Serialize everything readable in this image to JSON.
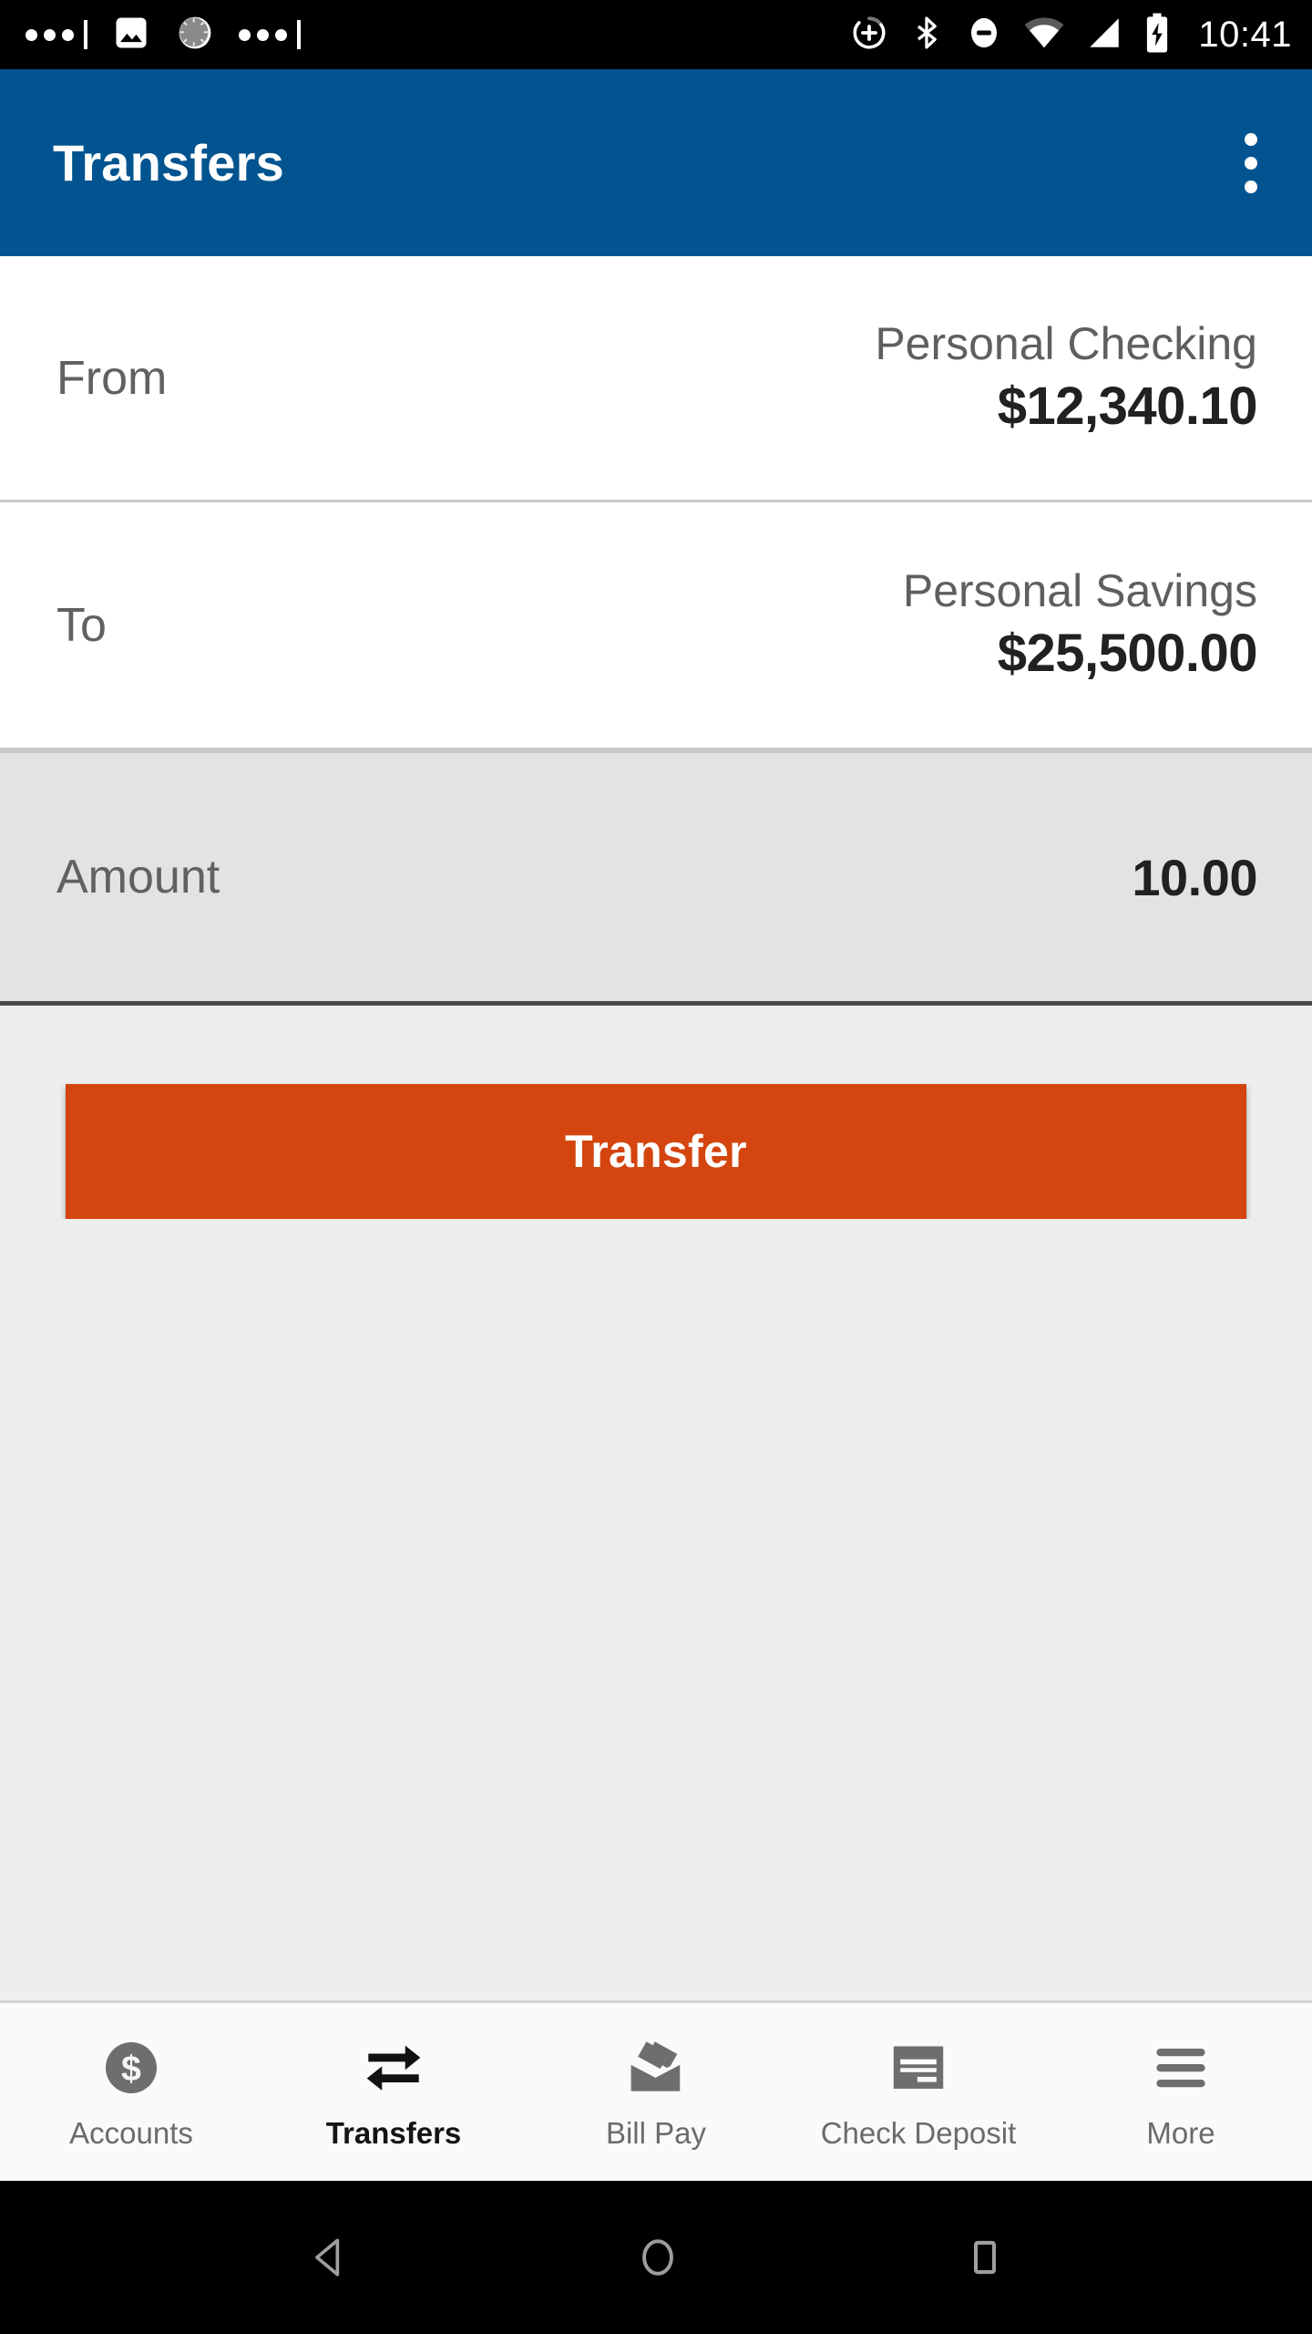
{
  "status_bar": {
    "time": "10:41",
    "left_icons": [
      "notification-overflow-dots",
      "image-icon",
      "sync-spinner-icon",
      "notification-overflow-dots"
    ],
    "right_icons": [
      "alarm-add-icon",
      "bluetooth-icon",
      "do-not-disturb-icon",
      "wifi-icon",
      "cellular-signal-icon",
      "battery-charging-icon"
    ],
    "background": "#000000",
    "foreground": "#ffffff"
  },
  "app_bar": {
    "title": "Transfers",
    "background": "#01548f",
    "title_color": "#ffffff",
    "overflow_menu": "more-options"
  },
  "form": {
    "rows": [
      {
        "label": "From",
        "account": "Personal Checking",
        "balance": "$12,340.10",
        "state": "normal"
      },
      {
        "label": "To",
        "account": "Personal Savings",
        "balance": "$25,500.00",
        "state": "normal"
      }
    ],
    "amount_row": {
      "label": "Amount",
      "value": "10.00",
      "state": "focused",
      "background": "#e3e3e3"
    }
  },
  "primary_action": {
    "label": "Transfer",
    "background": "#d4450f",
    "text_color": "#ffffff"
  },
  "tab_bar": {
    "active_index": 1,
    "tabs": [
      {
        "label": "Accounts",
        "icon": "dollar-circle-icon"
      },
      {
        "label": "Transfers",
        "icon": "transfer-arrows-icon"
      },
      {
        "label": "Bill Pay",
        "icon": "envelope-mail-icon"
      },
      {
        "label": "Check Deposit",
        "icon": "check-document-icon"
      },
      {
        "label": "More",
        "icon": "hamburger-menu-icon"
      }
    ],
    "inactive_color": "#6b6b6b",
    "active_color": "#141414"
  },
  "nav_bar": {
    "buttons": [
      "back-button",
      "home-button",
      "recents-button"
    ],
    "background": "#000000",
    "icon_color": "#9e9e9e"
  }
}
